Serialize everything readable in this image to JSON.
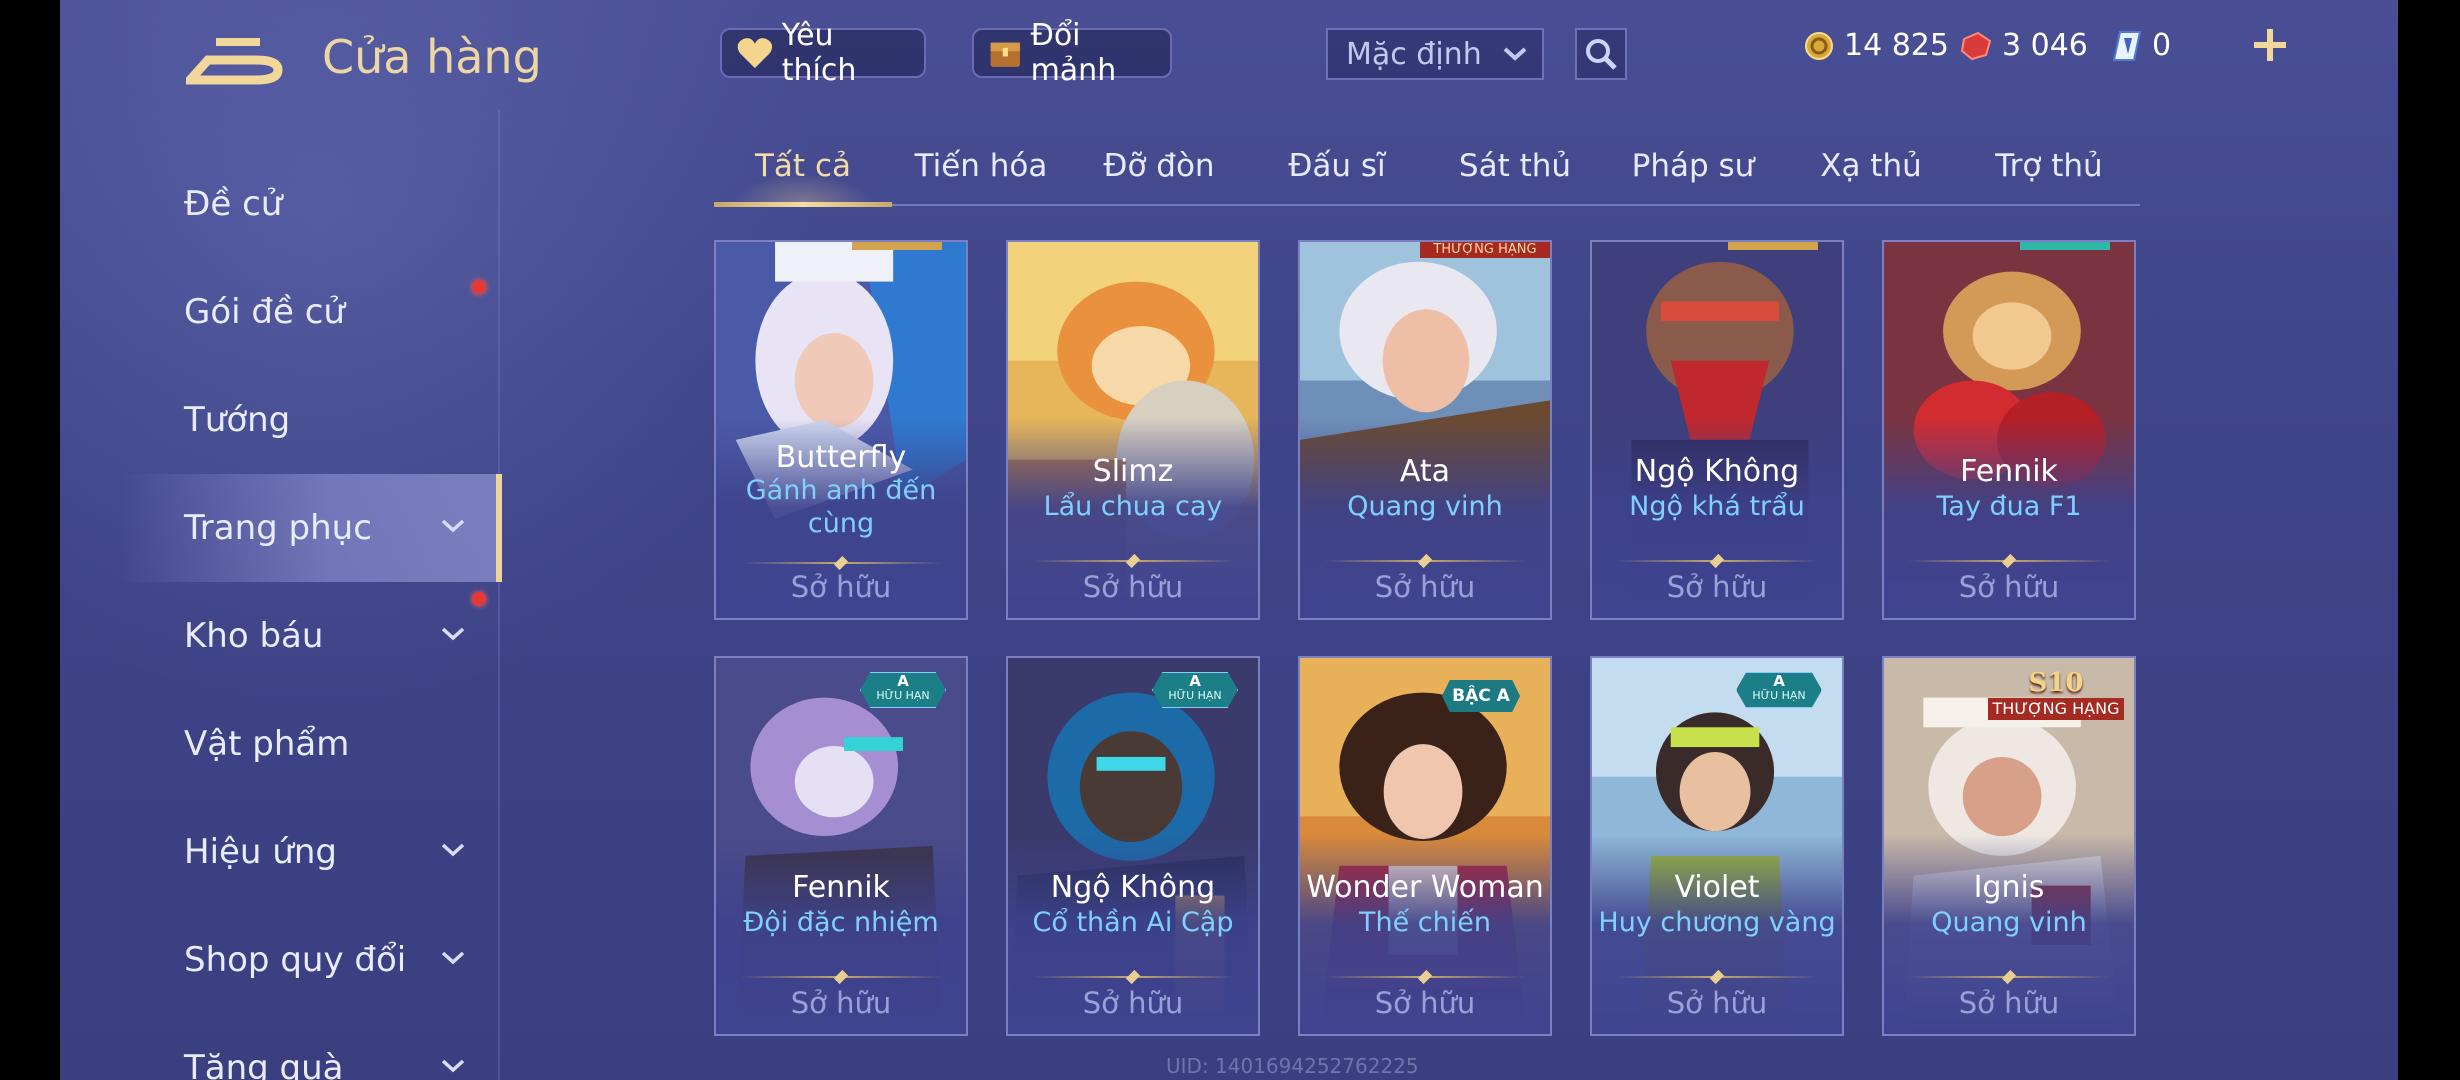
{
  "header": {
    "title": "Cửa hàng",
    "favorite_label": "Yêu thích",
    "exchange_label": "Đổi mảnh",
    "sort_value": "Mặc định"
  },
  "currencies": [
    {
      "icon": "gold-coin-icon",
      "value": "14 825"
    },
    {
      "icon": "red-voucher-icon",
      "value": "3 046"
    },
    {
      "icon": "blue-diamond-icon",
      "value": "0"
    }
  ],
  "sidebar": {
    "items": [
      {
        "label": "Đề cử"
      },
      {
        "label": "Gói đề cử"
      },
      {
        "label": "Tướng"
      },
      {
        "label": "Trang phục"
      },
      {
        "label": "Kho báu"
      },
      {
        "label": "Vật phẩm"
      },
      {
        "label": "Hiệu ứng"
      },
      {
        "label": "Shop quy đổi"
      },
      {
        "label": "Tặng quà"
      }
    ]
  },
  "tabs": [
    "Tất cả",
    "Tiến hóa",
    "Đỡ đòn",
    "Đấu sĩ",
    "Sát thủ",
    "Pháp sư",
    "Xạ thủ",
    "Trợ thủ"
  ],
  "cards": [
    {
      "hero": "Butterfly",
      "skin": "Gánh anh đến cùng",
      "status": "Sở hữu"
    },
    {
      "hero": "Slimz",
      "skin": "Lẩu chua cay",
      "status": "Sở hữu"
    },
    {
      "hero": "Ata",
      "skin": "Quang vinh",
      "status": "Sở hữu",
      "badge_top": "THƯỢNG HẠNG"
    },
    {
      "hero": "Ngộ Không",
      "skin": "Ngộ khá trẩu",
      "status": "Sở hữu"
    },
    {
      "hero": "Fennik",
      "skin": "Tay đua F1",
      "status": "Sở hữu"
    },
    {
      "hero": "Fennik",
      "skin": "Đội đặc nhiệm",
      "status": "Sở hữu",
      "badge": "A",
      "badge_sub": "HỮU HẠN"
    },
    {
      "hero": "Ngộ Không",
      "skin": "Cổ thần Ai Cập",
      "status": "Sở hữu",
      "badge": "A",
      "badge_sub": "HỮU HẠN"
    },
    {
      "hero": "Wonder Woman",
      "skin": "Thế chiến",
      "status": "Sở hữu",
      "badge": "BẬC A"
    },
    {
      "hero": "Violet",
      "skin": "Huy chương vàng",
      "status": "Sở hữu",
      "badge": "A",
      "badge_sub": "HỮU HẠN"
    },
    {
      "hero": "Ignis",
      "skin": "Quang vinh",
      "status": "Sở hữu",
      "badge": "S10",
      "badge_sub": "THƯỢNG HẠNG"
    }
  ],
  "footer": {
    "uid": "UID: 1401694252762225"
  },
  "colors": {
    "accent_gold": "#ecd6a4",
    "skin_name_blue": "#7fd0ff",
    "bg": "#3f4589"
  }
}
